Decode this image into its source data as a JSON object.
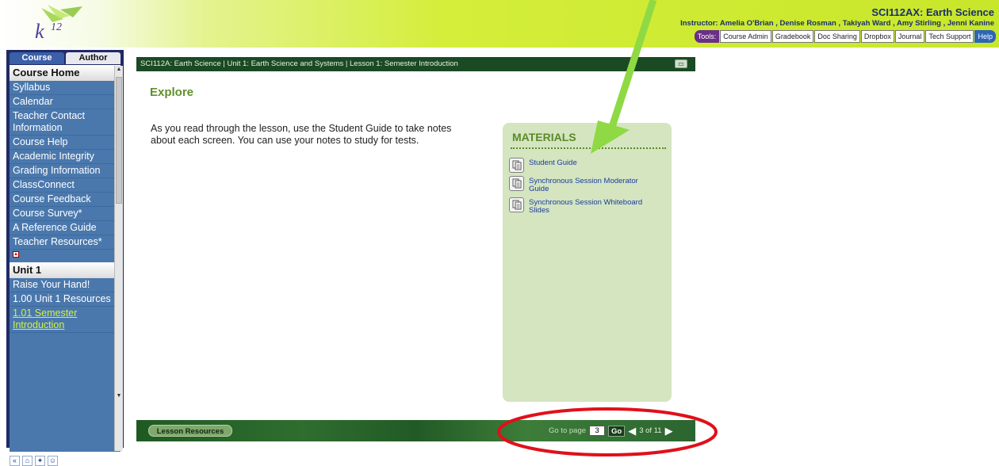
{
  "header": {
    "logo_text": "k12",
    "course_title": "SCI112AX: Earth Science",
    "instructors": "Instructor:  Amelia O'Brian , Denise Rosman , Takiyah Ward , Amy Stirling , Jenni Kanine",
    "tools_label": "Tools:",
    "tools": [
      "Course Admin",
      "Gradebook",
      "Doc Sharing",
      "Dropbox",
      "Journal",
      "Tech Support",
      "Help"
    ]
  },
  "sidebar": {
    "tabs": [
      "Course",
      "Author"
    ],
    "course_home": {
      "title": "Course Home",
      "items": [
        "Syllabus",
        "Calendar",
        "Teacher Contact Information",
        "Course Help",
        "Academic Integrity",
        "Grading Information",
        "ClassConnect",
        "Course Feedback",
        "Course Survey*",
        "A Reference Guide",
        "Teacher Resources*"
      ]
    },
    "unit": {
      "title": "Unit 1",
      "items": [
        "Raise Your Hand!",
        "1.00 Unit 1 Resources",
        "1.01 Semester Introduction"
      ],
      "current_item": "1.01 Semester Introduction"
    },
    "bottom_icons": [
      "collapse-icon",
      "home-icon",
      "lightbulb-icon",
      "person-icon"
    ]
  },
  "content": {
    "breadcrumb": "SCI112A: Earth Science | Unit 1: Earth Science and Systems | Lesson 1: Semester Introduction",
    "heading": "Explore",
    "body": "As you read through the lesson, use the Student Guide to take notes about each screen. You can use your notes to study for tests.",
    "materials": {
      "title": "MATERIALS",
      "items": [
        "Student Guide",
        "Synchronous Session Moderator Guide",
        "Synchronous Session Whiteboard Slides"
      ]
    },
    "footer": {
      "lesson_resources": "Lesson Resources",
      "go_to_page_label": "Go to page",
      "page_value": "3",
      "go_label": "Go",
      "page_count": "3 of 11"
    }
  },
  "colors": {
    "header_accent": "#d4ee3a",
    "sidebar_dark": "#1f2a66",
    "sidebar_panel": "#4a78ad",
    "content_green": "#1a4a23",
    "materials_bg": "#d4e5c0",
    "annotation_arrow": "#8fd944",
    "annotation_circle": "#e0101a"
  }
}
